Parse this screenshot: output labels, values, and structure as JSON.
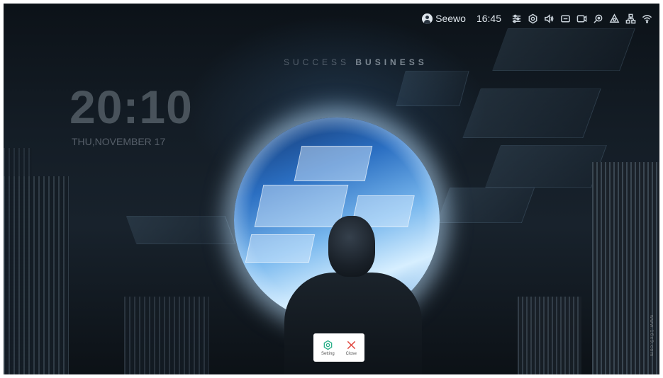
{
  "lock_screen": {
    "tagline_light": "SUCCESS",
    "tagline_bold": "BUSINESS",
    "time": "20:10",
    "date": "THU,NOVEMBER 17"
  },
  "status_bar": {
    "user_name": "Seewo",
    "time": "16:45",
    "icons": [
      "sliders-icon",
      "gear-icon",
      "volume-icon",
      "screen-icon",
      "record-icon",
      "search-icon",
      "cloud-icon",
      "network-icon",
      "wifi-icon"
    ]
  },
  "popup": {
    "setting_label": "Setting",
    "close_label": "Close",
    "setting_color": "#2bb08a",
    "close_color": "#e0443c"
  },
  "watermark": "www.16x9.com"
}
